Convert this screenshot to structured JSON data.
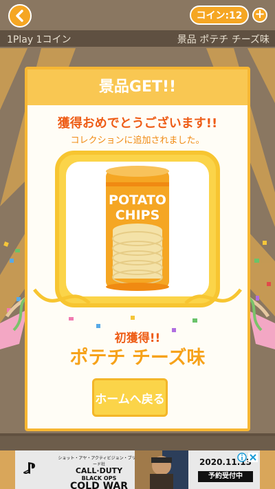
{
  "header": {
    "back_icon": "chevron-left-icon",
    "coins_label": "コイン:12",
    "add_coins_label": "+"
  },
  "info_bar": {
    "play_cost": "1Play 1コイン",
    "prize_label": "景品 ポテチ チーズ味"
  },
  "modal": {
    "title": "景品GET!!",
    "congrats": "獲得おめでとうございます!!",
    "added_to_collection": "コレクションに追加されました。",
    "prize_image": {
      "label_line1": "POTATO",
      "label_line2": "CHIPS"
    },
    "first_get": "初獲得!!",
    "prize_name": "ポテチ チーズ味",
    "home_button": "ホームへ戻る"
  },
  "ad": {
    "brand_small": "ショット・アヤ・アクティビジョン・ブリザード社",
    "title_line1": "CALL·DUTY",
    "title_line2": "BLACK OPS",
    "title_line3": "COLD WAR",
    "date": "2020.11.13",
    "cta": "予約受付中",
    "close_icon": "close-icon",
    "info_icon": "info-icon"
  },
  "colors": {
    "accent": "#f5a623",
    "modal_border": "#f7b733",
    "title_text": "#ee5d17"
  }
}
